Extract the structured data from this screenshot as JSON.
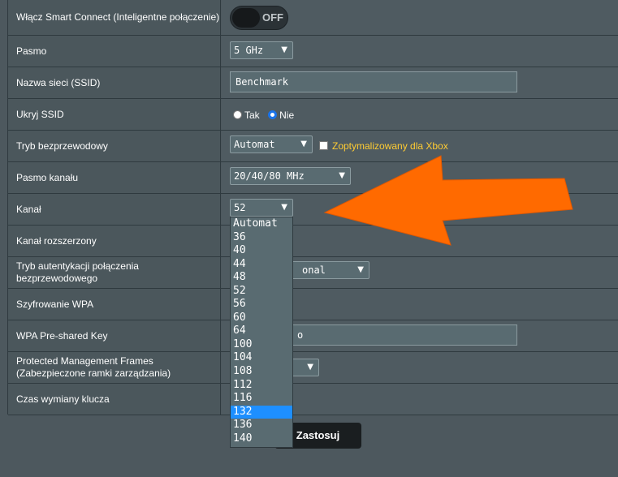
{
  "rows": {
    "smart_connect": {
      "label": "Włącz Smart Connect (Inteligentne połączenie)",
      "toggle": "OFF"
    },
    "band": {
      "label": "Pasmo",
      "value": "5 GHz"
    },
    "ssid": {
      "label": "Nazwa sieci (SSID)",
      "value": "Benchmark"
    },
    "hide_ssid": {
      "label": "Ukryj SSID",
      "options": [
        "Tak",
        "Nie"
      ],
      "selected": "Nie"
    },
    "wireless_mode": {
      "label": "Tryb bezprzewodowy",
      "value": "Automat",
      "xbox": "Zoptymalizowany dla Xbox"
    },
    "bandwidth": {
      "label": "Pasmo kanału",
      "value": "20/40/80 MHz"
    },
    "channel": {
      "label": "Kanał",
      "value": "52"
    },
    "ext_channel": {
      "label": "Kanał rozszerzony"
    },
    "auth": {
      "label": "Tryb autentykacji połączenia bezprzewodowego",
      "value_partial": "onal"
    },
    "wpa_enc": {
      "label": "Szyfrowanie WPA"
    },
    "psk": {
      "label": "WPA Pre-shared Key",
      "value_partial": "o"
    },
    "pmf": {
      "label": "Protected Management Frames (Zabezpieczone ramki zarządzania)"
    },
    "key_rotation": {
      "label": "Czas wymiany klucza"
    }
  },
  "channel_dropdown": {
    "options": [
      "Automat",
      "36",
      "40",
      "44",
      "48",
      "52",
      "56",
      "60",
      "64",
      "100",
      "104",
      "108",
      "112",
      "116",
      "132",
      "136",
      "140"
    ],
    "highlighted": "132"
  },
  "apply_button": {
    "label": "Zastosuj"
  },
  "colors": {
    "arrow": "#ff6a00",
    "highlight": "#1e8fff",
    "xbox_text": "#ffcc33"
  }
}
